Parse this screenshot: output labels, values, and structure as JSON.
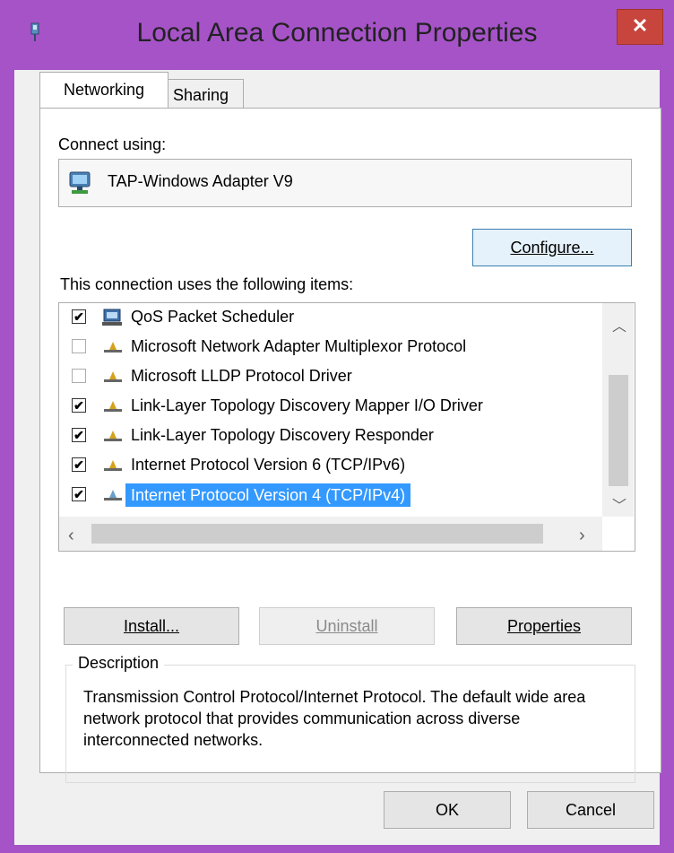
{
  "window": {
    "title": "Local Area Connection Properties",
    "close_glyph": "✕",
    "accent": "#a653c8"
  },
  "tabs": [
    {
      "label": "Networking",
      "active": true
    },
    {
      "label": "Sharing",
      "active": false
    }
  ],
  "connect_using": {
    "label": "Connect using:",
    "adapter": "TAP-Windows Adapter V9",
    "adapter_icon": "network-adapter-icon"
  },
  "configure_button": "Configure...",
  "items_label": "This connection uses the following items:",
  "items": [
    {
      "label": "QoS Packet Scheduler",
      "checked": true,
      "icon": "qos-scheduler-icon"
    },
    {
      "label": "Microsoft Network Adapter Multiplexor Protocol",
      "checked": false,
      "icon": "protocol-icon"
    },
    {
      "label": "Microsoft LLDP Protocol Driver",
      "checked": false,
      "icon": "protocol-icon"
    },
    {
      "label": "Link-Layer Topology Discovery Mapper I/O Driver",
      "checked": true,
      "icon": "protocol-icon"
    },
    {
      "label": "Link-Layer Topology Discovery Responder",
      "checked": true,
      "icon": "protocol-icon"
    },
    {
      "label": "Internet Protocol Version 6 (TCP/IPv6)",
      "checked": true,
      "icon": "protocol-icon"
    },
    {
      "label": "Internet Protocol Version 4 (TCP/IPv4)",
      "checked": true,
      "icon": "protocol-icon",
      "selected": true
    }
  ],
  "buttons": {
    "install": "Install...",
    "uninstall": "Uninstall",
    "properties": "Properties",
    "ok": "OK",
    "cancel": "Cancel"
  },
  "description": {
    "title": "Description",
    "text": "Transmission Control Protocol/Internet Protocol. The default wide area network protocol that provides communication across diverse interconnected networks."
  }
}
